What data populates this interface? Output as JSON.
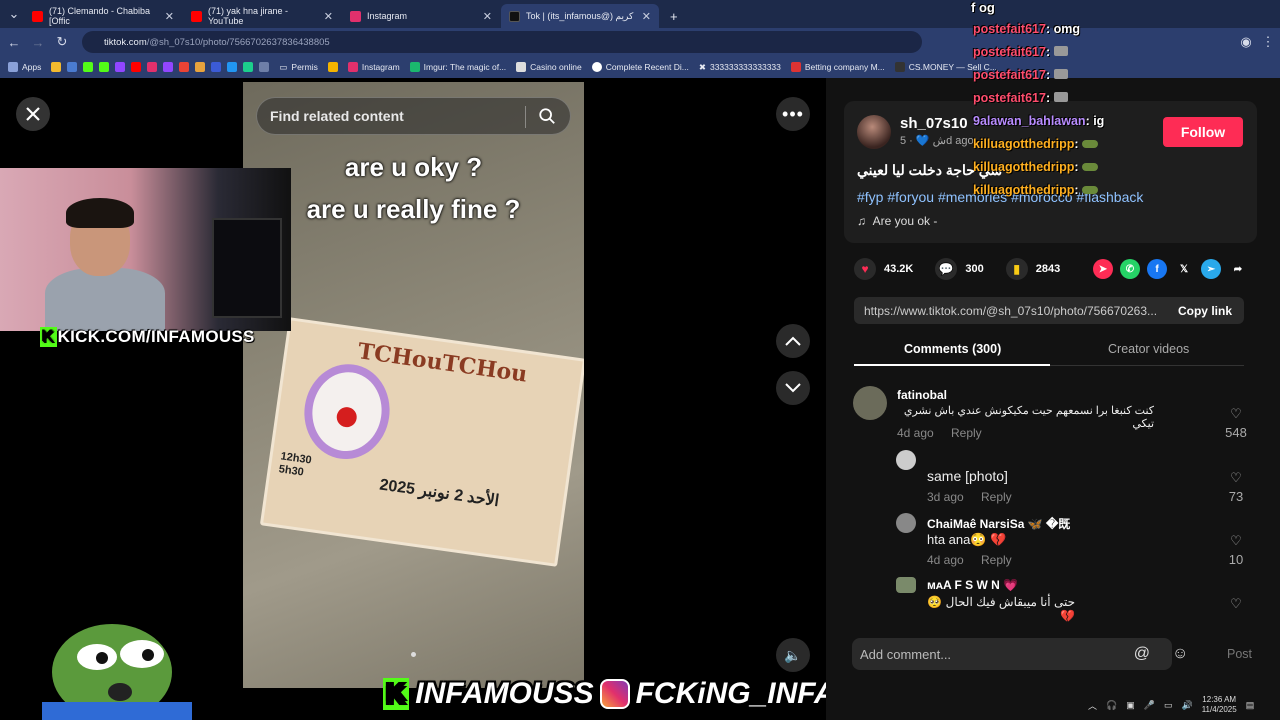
{
  "browser": {
    "tabs": [
      {
        "title": "(71) Clemando - Chabiba [Offic",
        "color": "#ff0000"
      },
      {
        "title": "(71) yak hna jirane - YouTube",
        "color": "#ff0000"
      },
      {
        "title": "Instagram",
        "color": "#e1306c"
      },
      {
        "title": "Tok | (its_infamous@) كريم",
        "color": "#111111"
      }
    ],
    "url_host": "tiktok.com",
    "url_path": "/@sh_07s10/photo/7566702637836438805",
    "bookmarks": [
      "Apps",
      "Permis",
      "Instagram",
      "Imgur: The magic of...",
      "Casino online",
      "Complete Recent Di...",
      "333333333333333",
      "Betting company M...",
      "CS.MONEY — Sell C..."
    ]
  },
  "viewer": {
    "search_placeholder": "Find related content",
    "caption_line1": "are u oky ?",
    "caption_line2": "are u really fine ?",
    "flyer_title": "TCHouTCHou",
    "flyer_date": "الأحد 2 نونبر 2025",
    "flyer_hours": "12h30\n5h30",
    "close_icon": "close-icon",
    "more_icon": "more-icon"
  },
  "overlay": {
    "kick_url": "KICK.COM/INFAMOUSS",
    "banner_kick": "INFAMOUSS",
    "banner_ig": "FCKiNG_INFAMOUS"
  },
  "post": {
    "username": "sh_07s10",
    "sub": "ش 💙 · 5d ago",
    "follow_label": "Follow",
    "description": "سي حاجة دخلت ليا لعيني",
    "tags": "#fyp #foryou #memories #morocco #flashback",
    "music": "Are you ok -",
    "likes": "43.2K",
    "comments": "300",
    "saves": "2843",
    "link": "https://www.tiktok.com/@sh_07s10/photo/756670263...",
    "copy_label": "Copy link",
    "tab_comments": "Comments (300)",
    "tab_creator": "Creator videos"
  },
  "comments": [
    {
      "name": "fatinobal",
      "text": "كنت كنبغا برا نسمعهم حيت مكيكونش عندي باش نشري تيكي",
      "time": "4d ago",
      "reply": "Reply",
      "likes": "548"
    },
    {
      "name": "",
      "text": "same [photo]",
      "time": "3d ago",
      "reply": "Reply",
      "likes": "73"
    },
    {
      "name": "ChaiMaê NarsiSa 🦋 �既",
      "text": "hta ana😳 💔",
      "time": "4d ago",
      "reply": "Reply",
      "likes": "10"
    },
    {
      "name": "ᴍᴀA F S W N 💗",
      "text": "حتى أنا ميبقاش فيك الحال 🥺 💔",
      "time": "",
      "reply": "",
      "likes": ""
    }
  ],
  "add_comment": {
    "placeholder": "Add comment...",
    "post_label": "Post"
  },
  "chat": [
    {
      "user": "f og",
      "msg": "",
      "color": "#ffffff"
    },
    {
      "user": "postefait617",
      "msg": ": omg",
      "color": "#ff4d6d"
    },
    {
      "user": "postefait617",
      "msg": ":",
      "color": "#ff4d6d"
    },
    {
      "user": "postefait617",
      "msg": ":",
      "color": "#ff4d6d"
    },
    {
      "user": "postefait617",
      "msg": ":",
      "color": "#ff4d6d"
    },
    {
      "user": "9alawan_bahlawan",
      "msg": ": ig",
      "color": "#b98cff"
    },
    {
      "user": "killuagotthedripp",
      "msg": ":",
      "color": "#ffb020"
    },
    {
      "user": "killuagotthedripp",
      "msg": ":",
      "color": "#ffb020"
    },
    {
      "user": "killuagotthedripp",
      "msg": ":",
      "color": "#ffb020"
    }
  ],
  "clock": {
    "time": "12:36 AM",
    "date": "11/4/2025"
  }
}
